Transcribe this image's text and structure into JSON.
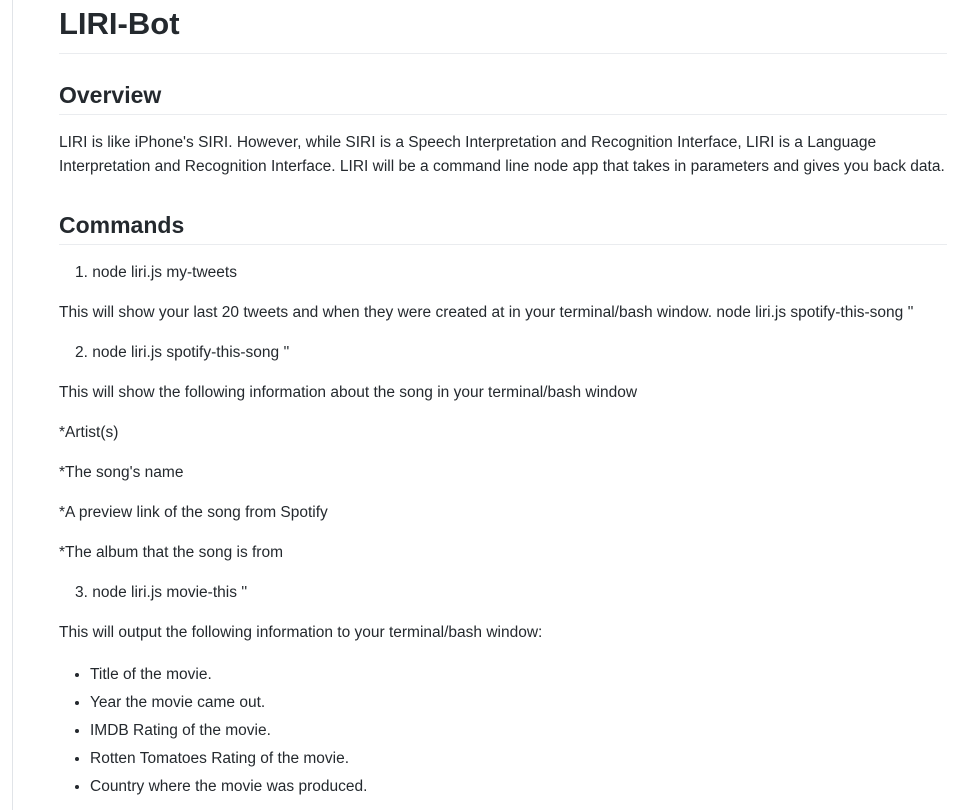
{
  "title": "LIRI-Bot",
  "overview": {
    "heading": "Overview",
    "text": "LIRI is like iPhone's SIRI. However, while SIRI is a Speech Interpretation and Recognition Interface, LIRI is a Language Interpretation and Recognition Interface. LIRI will be a command line node app that takes in parameters and gives you back data."
  },
  "commands": {
    "heading": "Commands",
    "cmd1": "1. node liri.js my-tweets",
    "cmd1_desc": "This will show your last 20 tweets and when they were created at in your terminal/bash window. node liri.js spotify-this-song ''",
    "cmd2": "2. node liri.js spotify-this-song ''",
    "cmd2_desc": "This will show the following information about the song in your terminal/bash window",
    "song_fields": [
      "*Artist(s)",
      "*The song's name",
      "*A preview link of the song from Spotify",
      "*The album that the song is from"
    ],
    "cmd3": "3. node liri.js movie-this ''",
    "cmd3_desc": "This will output the following information to your terminal/bash window:",
    "movie_fields": [
      "Title of the movie.",
      "Year the movie came out.",
      "IMDB Rating of the movie.",
      "Rotten Tomatoes Rating of the movie.",
      "Country where the movie was produced."
    ]
  }
}
